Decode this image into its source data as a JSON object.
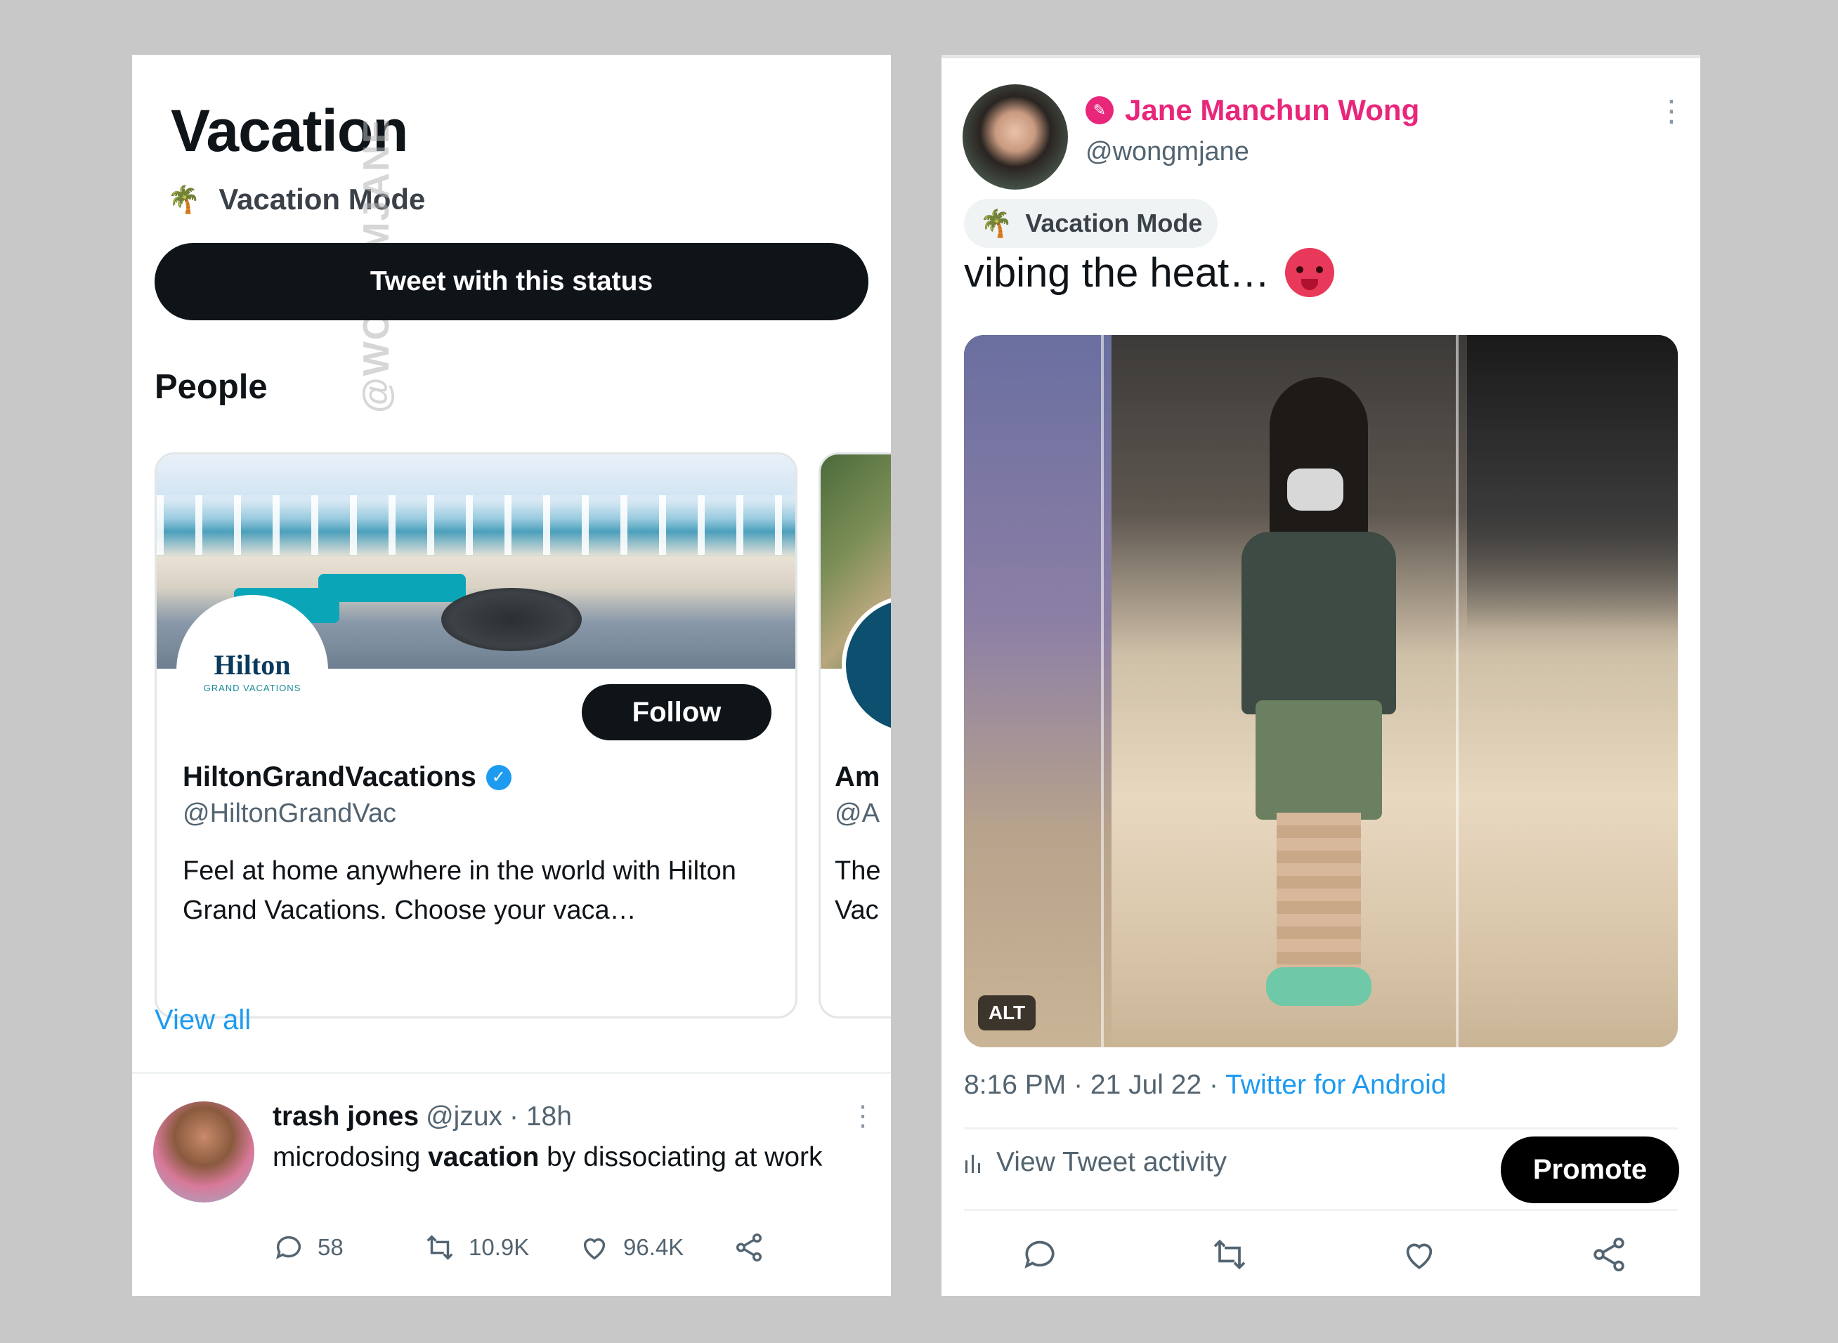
{
  "left": {
    "title": "Vacation",
    "status": {
      "icon": "palm-tree-icon",
      "label": "Vacation Mode"
    },
    "tweet_status_button": "Tweet with this status",
    "watermark": "@WONGMJANE",
    "people_heading": "People",
    "cards": [
      {
        "logo_word": "Hilton",
        "logo_sub": "GRAND VACATIONS",
        "follow_label": "Follow",
        "name": "HiltonGrandVacations",
        "verified": true,
        "handle": "@HiltonGrandVac",
        "bio": "Feel at home anywhere in the world with Hilton Grand Vacations. Choose your vaca…"
      },
      {
        "name": "Am",
        "handle": "@A",
        "bio_line1": "The",
        "bio_line2": "Vac"
      }
    ],
    "view_all": "View all",
    "tweet": {
      "author": "trash jones",
      "handle": "@jzux",
      "time": "· 18h",
      "text_before": "microdosing ",
      "text_bold": "vacation",
      "text_after": " by dissociating at work",
      "replies": "58",
      "retweets": "10.9K",
      "likes": "96.4K"
    }
  },
  "right": {
    "name": "Jane Manchun Wong",
    "handle": "@wongmjane",
    "status": {
      "icon": "palm-tree-icon",
      "label": "Vacation Mode"
    },
    "text": "vibing the heat…",
    "emoji": "hot-face-icon",
    "alt_badge": "ALT",
    "timestamp": "8:16 PM · 21 Jul 22 · ",
    "client": "Twitter for Android",
    "view_activity": "View Tweet activity",
    "promote": "Promote"
  },
  "colors": {
    "accent": "#1d9bf0",
    "name_pink": "#e8267a",
    "button_dark": "#0f1419",
    "muted": "#536471",
    "background": "#c8c8c8"
  }
}
